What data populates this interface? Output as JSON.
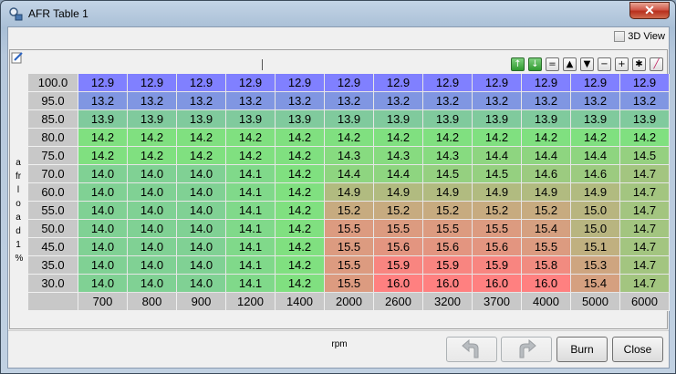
{
  "window": {
    "title": "AFR Table 1",
    "close_glyph": "✕"
  },
  "view3d": {
    "label": "3D View",
    "checked": false
  },
  "toolbar": {
    "buttons": [
      {
        "name": "increment-green-icon",
        "glyph": "↑"
      },
      {
        "name": "decrement-green-icon",
        "glyph": "↓"
      },
      {
        "name": "set-equal-icon",
        "glyph": "="
      },
      {
        "name": "shift-up-icon",
        "glyph": "▲"
      },
      {
        "name": "shift-down-icon",
        "glyph": "▼"
      },
      {
        "name": "minus-icon",
        "glyph": "−"
      },
      {
        "name": "plus-icon",
        "glyph": "+"
      },
      {
        "name": "multiply-icon",
        "glyph": "✱"
      },
      {
        "name": "interpolate-pen-icon",
        "glyph": "╱"
      }
    ]
  },
  "table": {
    "y_axis_label": "afrload1 %",
    "x_axis_label": "rpm",
    "y_values": [
      "100.0",
      "95.0",
      "85.0",
      "80.0",
      "75.0",
      "70.0",
      "60.0",
      "55.0",
      "50.0",
      "45.0",
      "35.0",
      "30.0"
    ],
    "x_values": [
      "700",
      "800",
      "900",
      "1200",
      "1400",
      "2000",
      "2600",
      "3200",
      "3700",
      "4000",
      "5000",
      "6000"
    ],
    "rows": [
      [
        "12.9",
        "12.9",
        "12.9",
        "12.9",
        "12.9",
        "12.9",
        "12.9",
        "12.9",
        "12.9",
        "12.9",
        "12.9",
        "12.9"
      ],
      [
        "13.2",
        "13.2",
        "13.2",
        "13.2",
        "13.2",
        "13.2",
        "13.2",
        "13.2",
        "13.2",
        "13.2",
        "13.2",
        "13.2"
      ],
      [
        "13.9",
        "13.9",
        "13.9",
        "13.9",
        "13.9",
        "13.9",
        "13.9",
        "13.9",
        "13.9",
        "13.9",
        "13.9",
        "13.9"
      ],
      [
        "14.2",
        "14.2",
        "14.2",
        "14.2",
        "14.2",
        "14.2",
        "14.2",
        "14.2",
        "14.2",
        "14.2",
        "14.2",
        "14.2"
      ],
      [
        "14.2",
        "14.2",
        "14.2",
        "14.2",
        "14.2",
        "14.3",
        "14.3",
        "14.3",
        "14.4",
        "14.4",
        "14.4",
        "14.5"
      ],
      [
        "14.0",
        "14.0",
        "14.0",
        "14.1",
        "14.2",
        "14.4",
        "14.4",
        "14.5",
        "14.5",
        "14.6",
        "14.6",
        "14.7"
      ],
      [
        "14.0",
        "14.0",
        "14.0",
        "14.1",
        "14.2",
        "14.9",
        "14.9",
        "14.9",
        "14.9",
        "14.9",
        "14.9",
        "14.7"
      ],
      [
        "14.0",
        "14.0",
        "14.0",
        "14.1",
        "14.2",
        "15.2",
        "15.2",
        "15.2",
        "15.2",
        "15.2",
        "15.0",
        "14.7"
      ],
      [
        "14.0",
        "14.0",
        "14.0",
        "14.1",
        "14.2",
        "15.5",
        "15.5",
        "15.5",
        "15.5",
        "15.4",
        "15.0",
        "14.7"
      ],
      [
        "14.0",
        "14.0",
        "14.0",
        "14.1",
        "14.2",
        "15.5",
        "15.6",
        "15.6",
        "15.6",
        "15.5",
        "15.1",
        "14.7"
      ],
      [
        "14.0",
        "14.0",
        "14.0",
        "14.1",
        "14.2",
        "15.5",
        "15.9",
        "15.9",
        "15.9",
        "15.8",
        "15.3",
        "14.7"
      ],
      [
        "14.0",
        "14.0",
        "14.0",
        "14.1",
        "14.2",
        "15.5",
        "16.0",
        "16.0",
        "16.0",
        "16.0",
        "15.4",
        "14.7"
      ]
    ]
  },
  "buttons": {
    "undo": "undo-icon",
    "redo": "redo-icon",
    "burn": "Burn",
    "close": "Close"
  },
  "colors": {
    "low": "#8080ff",
    "mid": "#80e080",
    "high": "#ff8080"
  }
}
